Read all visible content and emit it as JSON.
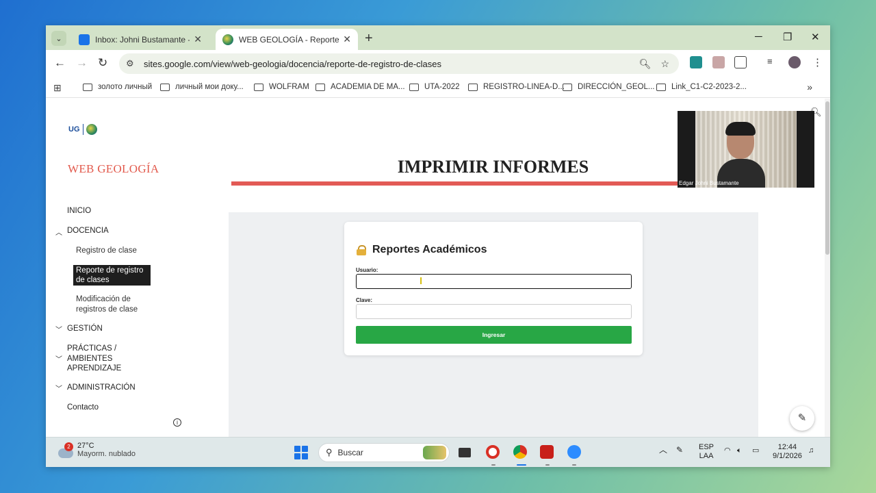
{
  "browser": {
    "tabs": [
      {
        "label": "Inbox: Johni Bustamante - Outl",
        "active": false
      },
      {
        "label": "WEB GEOLOGÍA - Reporte de re",
        "active": true
      }
    ],
    "tab_close": "✕",
    "new_tab": "+",
    "window_controls": {
      "minimize": "─",
      "maximize": "❐",
      "close": "✕"
    },
    "url": "sites.google.com/view/web-geologia/docencia/reporte-de-registro-de-clases",
    "bookmarks": [
      "золото личный",
      "личный мои доку...",
      "WOLFRAM",
      "ACADEMIA DE MA...",
      "UTA-2022",
      "REGISTRO-LINEA-D...",
      "DIRECCIÓN_GEOL...",
      "Link_C1-C2-2023-2..."
    ],
    "bookmarks_more": "»"
  },
  "site": {
    "logo_text": "UG",
    "title": "WEB GEOLOGÍA",
    "nav": {
      "inicio": "INICIO",
      "docencia": "DOCENCIA",
      "registro": "Registro de clase",
      "reporte_l1": "Reporte de registro",
      "reporte_l2": "de clases",
      "modif_l1": "Modificación de",
      "modif_l2": "registros de clase",
      "gestion": "GESTIÓN",
      "practicas_l1": "PRÁCTICAS /",
      "practicas_l2": "AMBIENTES",
      "practicas_l3": "APRENDIZAJE",
      "admin": "ADMINISTRACIÓN",
      "contacto": "Contacto"
    },
    "page_title": "IMPRIMIR INFORMES"
  },
  "form": {
    "title": "Reportes Académicos",
    "usuario_label": "Usuario:",
    "usuario_value": "",
    "clave_label": "Clave:",
    "clave_value": "",
    "submit": "Ingresar"
  },
  "video": {
    "name": "Edgar Johni Bustamante"
  },
  "taskbar": {
    "weather_badge": "2",
    "temperature": "27°C",
    "condition": "Mayorm. nublado",
    "search_placeholder": "Buscar",
    "lang1": "ESP",
    "lang2": "LAA",
    "time": "12:44",
    "date": "9/1/2026"
  },
  "colors": {
    "accent_red": "#e25a55",
    "site_title": "#e25a4d",
    "login_button": "#28a745"
  }
}
